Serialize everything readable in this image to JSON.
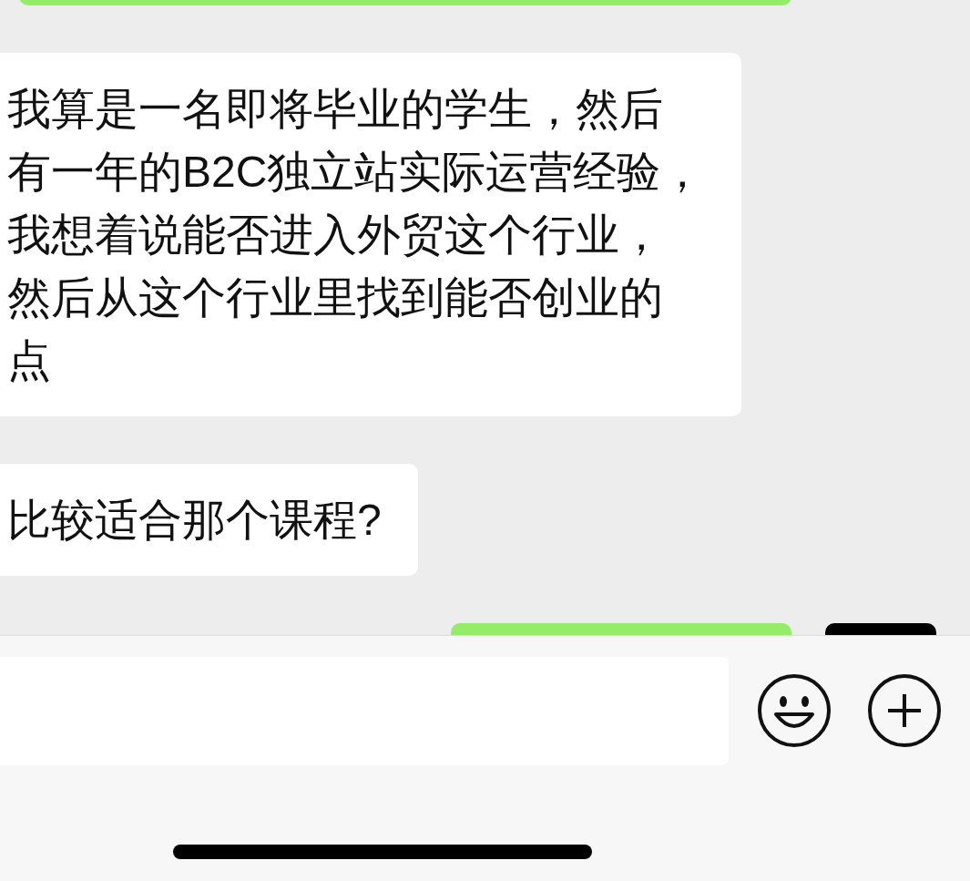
{
  "messages": [
    {
      "kind": "sent",
      "avatar": false
    },
    {
      "kind": "received",
      "text": "我算是一名即将毕业的学生，然后有一年的B2C独立站实际运营经验，我想着说能否进入外贸这个行业，然后从这个行业里找到能否创业的点"
    },
    {
      "kind": "received",
      "text": "比较适合那个课程?"
    },
    {
      "kind": "sent",
      "avatar": true
    }
  ]
}
